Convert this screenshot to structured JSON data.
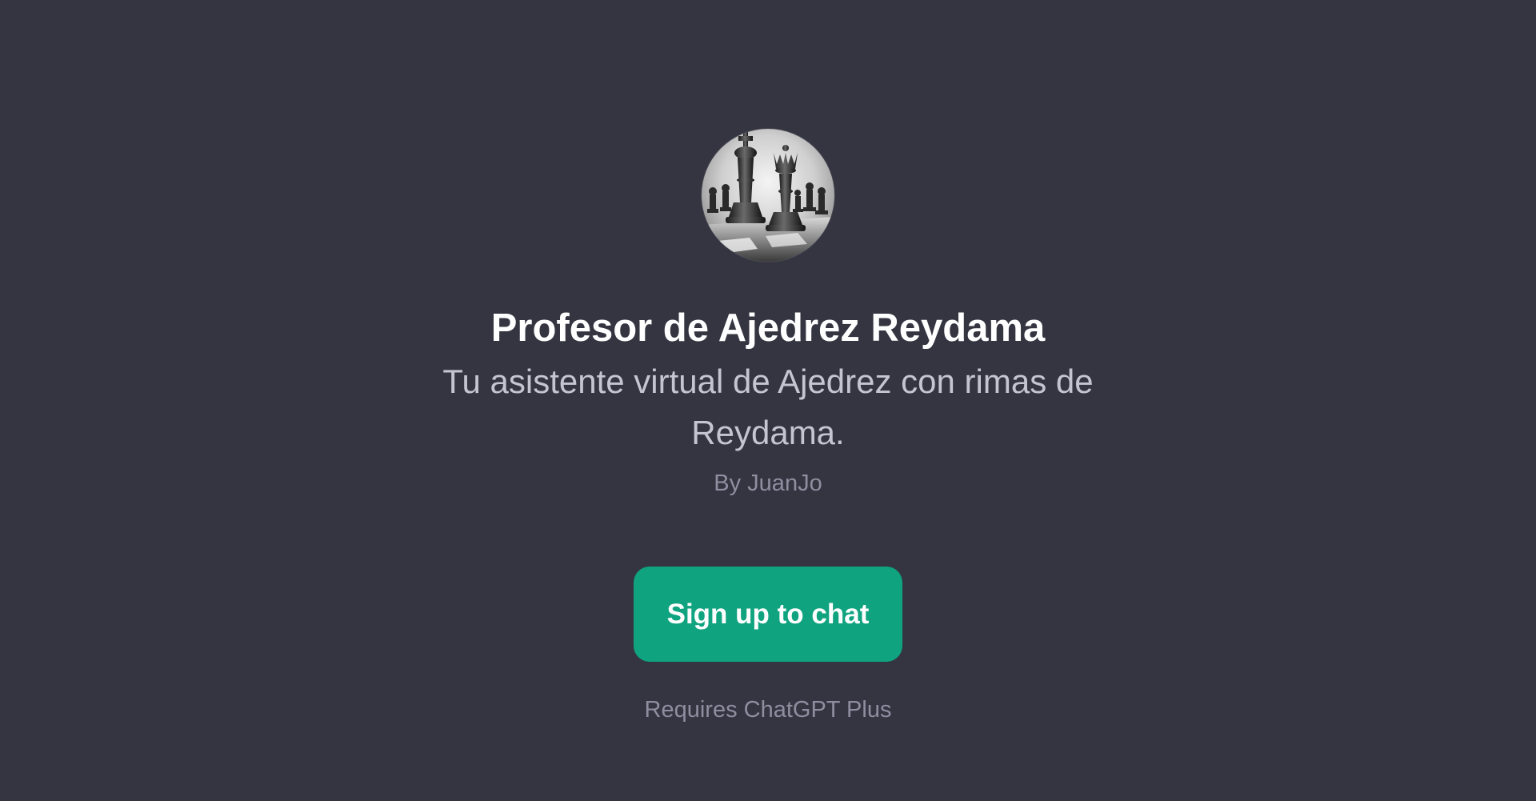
{
  "gpt": {
    "avatar_icon": "chess-pieces-icon",
    "title": "Profesor de Ajedrez Reydama",
    "description": "Tu asistente virtual de Ajedrez con rimas de Reydama.",
    "author": "By JuanJo"
  },
  "actions": {
    "signup_label": "Sign up to chat",
    "requirement": "Requires ChatGPT Plus"
  },
  "colors": {
    "background": "#343541",
    "accent": "#10a37f",
    "title": "#ffffff",
    "subtitle": "#c5c5d2",
    "muted": "#8e8ea0"
  }
}
